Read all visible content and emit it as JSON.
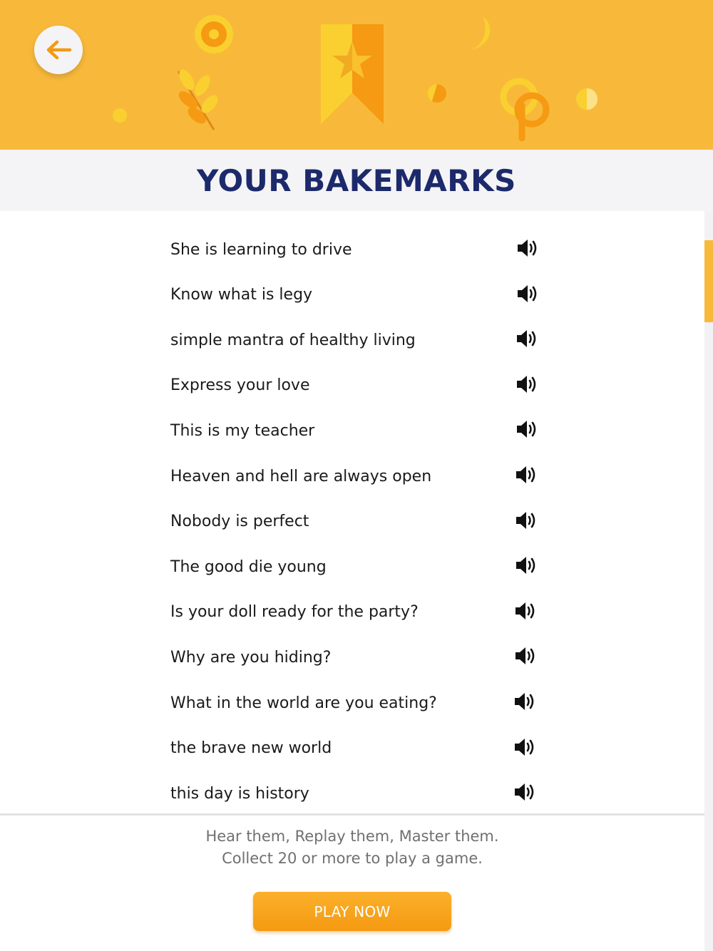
{
  "header": {
    "back_icon": "arrow-left-icon"
  },
  "page_title": "YOUR BAKEMARKS",
  "bakemarks": [
    {
      "phrase": "She is learning to drive"
    },
    {
      "phrase": "Know what is legy"
    },
    {
      "phrase": "simple mantra of healthy living"
    },
    {
      "phrase": "Express your love"
    },
    {
      "phrase": "This is my teacher"
    },
    {
      "phrase": "Heaven and hell are always open"
    },
    {
      "phrase": "Nobody is perfect"
    },
    {
      "phrase": "The good die young"
    },
    {
      "phrase": "Is your doll ready for the party?"
    },
    {
      "phrase": "Why are you hiding?"
    },
    {
      "phrase": "What in the world are you eating?"
    },
    {
      "phrase": "the brave new world"
    },
    {
      "phrase": "this day is history"
    }
  ],
  "footer": {
    "line1": "Hear them, Replay them, Master them.",
    "line2": "Collect 20 or more to play a game.",
    "play_label": "PLAY NOW"
  },
  "colors": {
    "brand": "#f8b93b",
    "accent": "#f59a12",
    "title": "#1c2a6b"
  }
}
